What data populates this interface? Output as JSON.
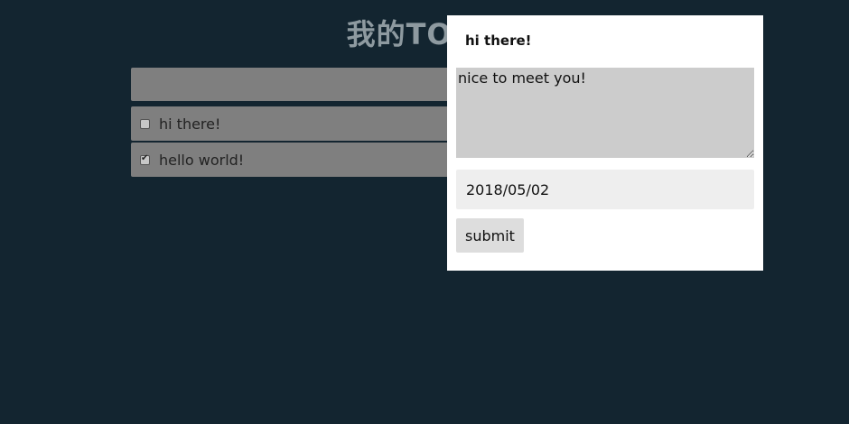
{
  "app": {
    "title": "我的TODO"
  },
  "todos": [
    {
      "text": "hi there!",
      "checked": false
    },
    {
      "text": "hello world!",
      "checked": true
    }
  ],
  "modal": {
    "title": "hi there!",
    "textarea_value": "nice to meet you!",
    "date_value": "2018/05/02",
    "submit_label": "submit"
  },
  "colors": {
    "background": "#132530",
    "item_background": "#7f7f7f",
    "modal_background": "#ffffff",
    "textarea_background": "#cccccc",
    "date_background": "#eeeeee",
    "button_background": "#dddddd"
  }
}
